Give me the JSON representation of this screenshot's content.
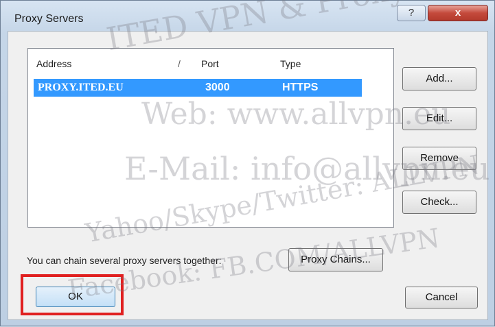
{
  "window": {
    "title": "Proxy Servers",
    "help_label": "?",
    "close_label": "x"
  },
  "proxy_list": {
    "columns": [
      "Address",
      "Port",
      "Type"
    ],
    "rows": [
      {
        "address": "PROXY.ITED.EU",
        "port": "3000",
        "type": "HTTPS",
        "selected": true
      }
    ]
  },
  "buttons": {
    "add": "Add...",
    "edit": "Edit...",
    "remove": "Remove",
    "check": "Check...",
    "proxy_chains": "Proxy Chains...",
    "ok": "OK",
    "cancel": "Cancel"
  },
  "chain_hint": "You can chain several proxy servers together:",
  "watermark": {
    "line1": "ITED VPN & Proxy Services",
    "line2": "Web: www.allvpn.eu",
    "line3": "E-Mail: info@allvpn.eu",
    "line4": "Yahoo/Skype/Twitter: ALLVPN",
    "line5": "Facebook: FB.COM/ALLVPN"
  },
  "colors": {
    "selection": "#3399ff",
    "highlight_frame": "#e02020",
    "close_button": "#c44a3c"
  }
}
